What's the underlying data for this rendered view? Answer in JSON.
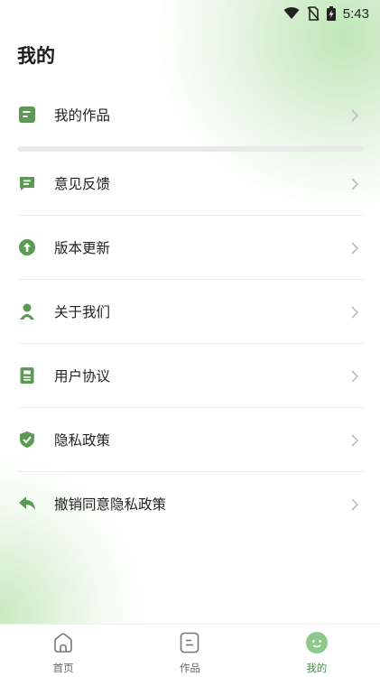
{
  "status_bar": {
    "time": "5:43",
    "icons": [
      "wifi-icon",
      "no-sim-icon",
      "battery-charging-icon"
    ]
  },
  "page": {
    "title": "我的"
  },
  "colors": {
    "accent": "#5a9a55",
    "accent_light": "#8cc98a",
    "chevron": "#bdbdbd"
  },
  "menu": {
    "items": [
      {
        "label": "我的作品",
        "icon": "works-icon"
      },
      {
        "label": "意见反馈",
        "icon": "feedback-icon"
      },
      {
        "label": "版本更新",
        "icon": "update-icon"
      },
      {
        "label": "关于我们",
        "icon": "about-icon"
      },
      {
        "label": "用户协议",
        "icon": "agreement-icon"
      },
      {
        "label": "隐私政策",
        "icon": "privacy-shield-icon"
      },
      {
        "label": "撤销同意隐私政策",
        "icon": "revoke-icon"
      }
    ]
  },
  "tabbar": {
    "tabs": [
      {
        "label": "首页",
        "icon": "home-icon"
      },
      {
        "label": "作品",
        "icon": "works-tab-icon"
      },
      {
        "label": "我的",
        "icon": "smile-icon",
        "active": true
      }
    ]
  }
}
